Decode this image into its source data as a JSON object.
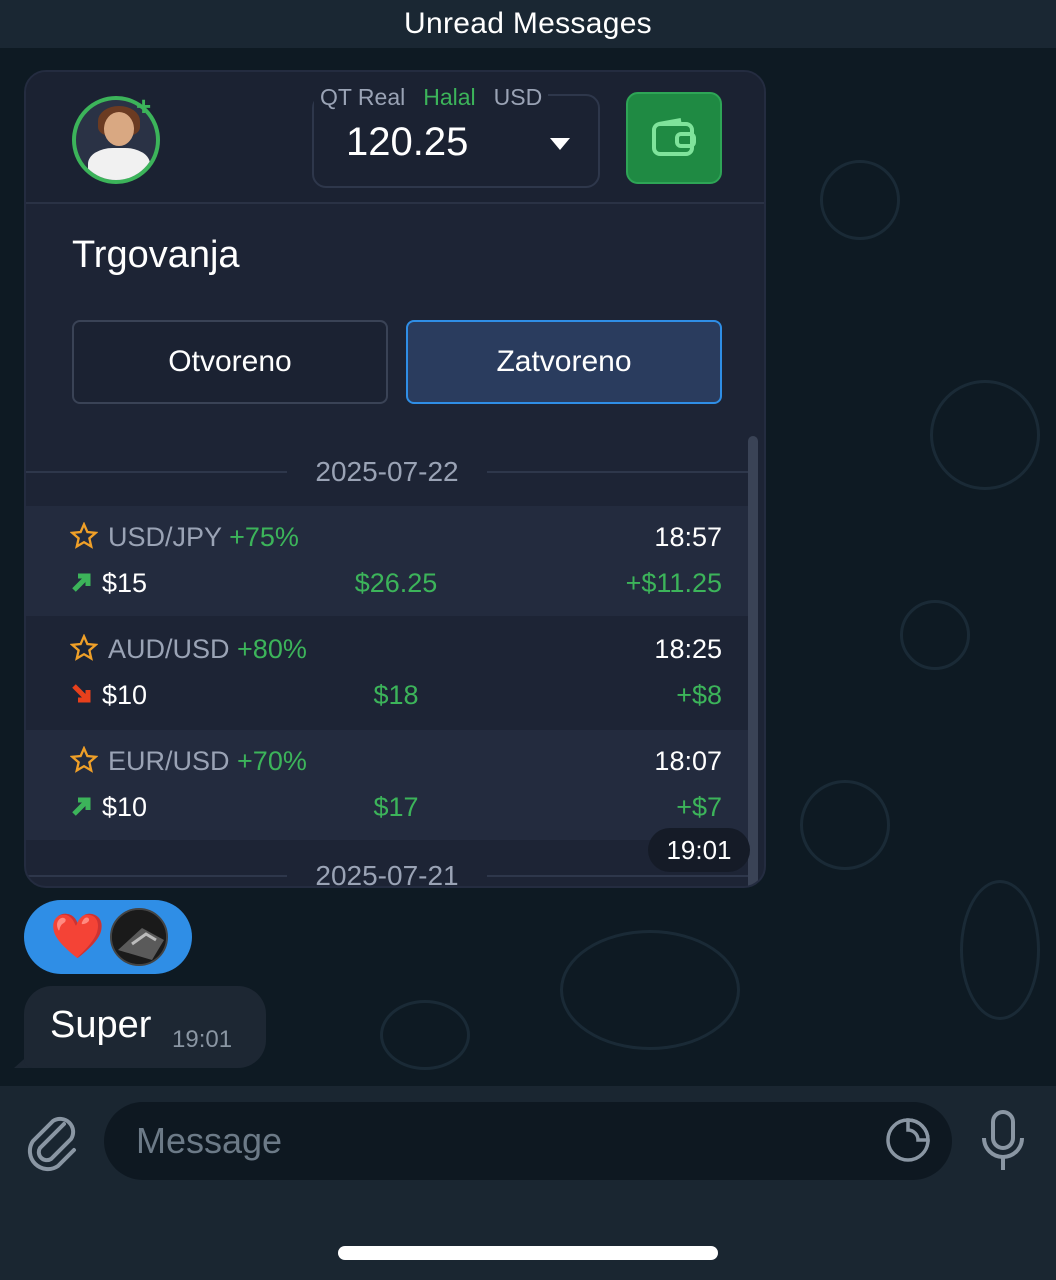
{
  "top_bar": {
    "title": "Unread Messages"
  },
  "screenshot": {
    "header": {
      "account_type": "QT Real",
      "account_mode": "Halal",
      "currency": "USD",
      "balance": "120.25"
    },
    "section_title": "Trgovanja",
    "tabs": [
      {
        "label": "Otvoreno",
        "active": false
      },
      {
        "label": "Zatvoreno",
        "active": true
      }
    ],
    "dates": [
      "2025-07-22",
      "2025-07-21"
    ],
    "trades": [
      {
        "pair": "USD/JPY",
        "percent": "+75%",
        "time": "18:57",
        "direction": "up",
        "amount": "$15",
        "payout": "$26.25",
        "profit": "+$11.25"
      },
      {
        "pair": "AUD/USD",
        "percent": "+80%",
        "time": "18:25",
        "direction": "down",
        "amount": "$10",
        "payout": "$18",
        "profit": "+$8"
      },
      {
        "pair": "EUR/USD",
        "percent": "+70%",
        "time": "18:07",
        "direction": "up",
        "amount": "$10",
        "payout": "$17",
        "profit": "+$7"
      }
    ],
    "sent_time": "19:01"
  },
  "reactions": {
    "emoji": "❤️"
  },
  "reply": {
    "text": "Super",
    "time": "19:01"
  },
  "composer": {
    "placeholder": "Message"
  },
  "colors": {
    "accent_green": "#3cb45a",
    "accent_blue": "#2f8ee6",
    "down_red": "#e8401c",
    "chat_bg": "#0e1a23"
  }
}
